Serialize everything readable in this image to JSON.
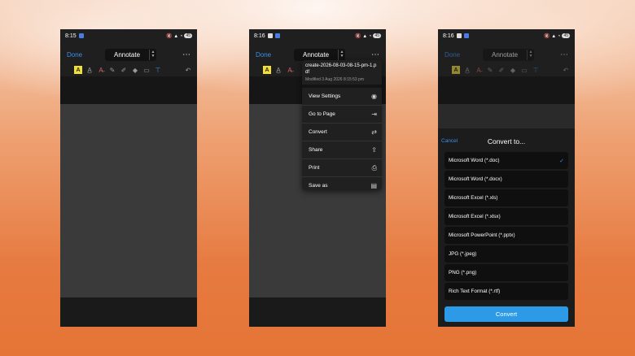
{
  "phones": [
    {
      "status_time": "8:15",
      "done": "Done",
      "mode": "Annotate",
      "battery": "45"
    },
    {
      "status_time": "8:16",
      "done": "Done",
      "mode": "Annotate",
      "battery": "45"
    },
    {
      "status_time": "8:16",
      "done": "Done",
      "mode": "Annotate",
      "battery": "45"
    }
  ],
  "more_icon": "⋯",
  "menu": {
    "filename": "create-2026-08-03-08-15-pm-1.pdf",
    "modified": "Modified 3 Aug 2026 8:15:53 pm",
    "items": [
      {
        "label": "View Settings",
        "icon": "eye-icon"
      },
      {
        "label": "Go to Page",
        "icon": "go-to-page-icon"
      },
      {
        "label": "Convert",
        "icon": "convert-icon"
      },
      {
        "label": "Share",
        "icon": "share-icon"
      },
      {
        "label": "Print",
        "icon": "printer-icon"
      },
      {
        "label": "Save as",
        "icon": "save-as-icon"
      }
    ]
  },
  "convert_sheet": {
    "cancel": "Cancel",
    "title": "Convert to...",
    "options": [
      "Microsoft Word (*.doc)",
      "Microsoft Word (*.docx)",
      "Microsoft Excel (*.xls)",
      "Microsoft Excel (*.xlsx)",
      "Microsoft PowerPoint (*.pptx)",
      "JPG (*.jpeg)",
      "PNG (*.png)",
      "Rich Text Format (*.rtf)"
    ],
    "selected_index": 0,
    "button": "Convert"
  },
  "colors": {
    "accent": "#3b8fe8",
    "highlight": "#f2e035",
    "convert_button": "#2d9ae8"
  }
}
